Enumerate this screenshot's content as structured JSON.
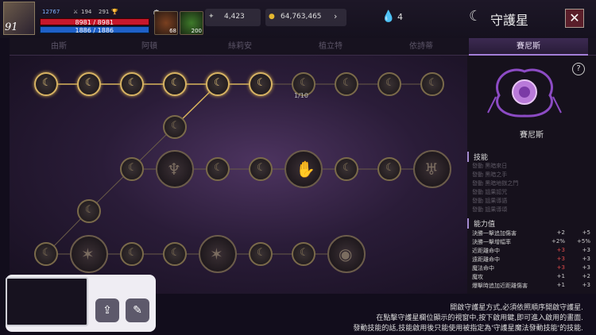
{
  "player": {
    "level": "91",
    "stat_a": "12767",
    "stat_b": "194",
    "stat_c": "291",
    "hp": "8981 / 8981",
    "mp": "1886 / 1886",
    "slot1_count": "68",
    "slot2_count": "200"
  },
  "currency": {
    "silver": "4,423",
    "gold": "64,763,465",
    "gems": "4"
  },
  "title": "守護星",
  "tabs": [
    "由斯",
    "阿頓",
    "絲莉安",
    "植立特",
    "依詩蒂",
    "賽尼斯"
  ],
  "active_tab": 5,
  "board": {
    "progress_label": "1/10"
  },
  "panel": {
    "name": "賽尼斯",
    "skills_header": "技能",
    "skills": [
      "發動 黑暗來日",
      "發動 黑暗之手",
      "發動 黑暗地獄之門",
      "發動 詛果認咒",
      "發動 詛果導語",
      "發動 詛果導頌"
    ],
    "stats_header": "能力值",
    "stats": [
      {
        "label": "決勝一擊追加傷害",
        "v1": "+2",
        "v2": "+5",
        "neg": false
      },
      {
        "label": "決勝一擊增幅率",
        "v1": "+2%",
        "v2": "+5%",
        "neg": false
      },
      {
        "label": "近距離命中",
        "v1": "+3",
        "v2": "+3",
        "neg": true
      },
      {
        "label": "遠距離命中",
        "v1": "+3",
        "v2": "+3",
        "neg": true
      },
      {
        "label": "魔法命中",
        "v1": "+3",
        "v2": "+3",
        "neg": true
      },
      {
        "label": "魔攻",
        "v1": "+1",
        "v2": "+2",
        "neg": false
      },
      {
        "label": "爆擊時追加近距離傷害",
        "v1": "+1",
        "v2": "+3",
        "neg": false
      }
    ]
  },
  "info": [
    "開啟守護星方式,必須依照順序開啟守護星.",
    "在點擊守護星欄位顯示的視窗中,按下啟用鍵,即可進入啟用的畫面.",
    "發動技能的話,技能啟用後只能使用被指定為'守護星魔法發動技能'的技能."
  ],
  "icons": {
    "close": "close-icon",
    "help": "help-icon",
    "share": "share-icon",
    "edit": "edit-icon"
  }
}
